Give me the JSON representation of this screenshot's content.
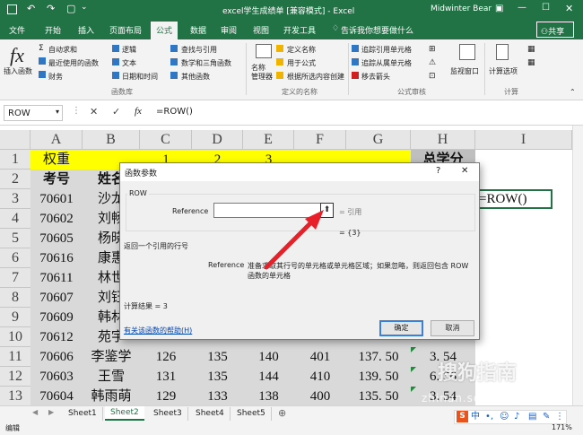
{
  "window": {
    "title": "excel学生成绩单 [兼容模式] - Excel",
    "user": "Midwinter Bear"
  },
  "tabs": [
    "文件",
    "开始",
    "插入",
    "页面布局",
    "公式",
    "数据",
    "审阅",
    "视图",
    "开发工具"
  ],
  "tell_me": "告诉我你想要做什么",
  "share": "共享",
  "ribbon": {
    "insert_function": "插入函数",
    "lib_col1": [
      "自动求和",
      "最近使用的函数",
      "财务"
    ],
    "lib_col2": [
      "逻辑",
      "文本",
      "日期和时间"
    ],
    "lib_col3": [
      "查找与引用",
      "数学和三角函数",
      "其他函数"
    ],
    "lib_group": "函数库",
    "name_manager": "名称\n管理器",
    "names_col": [
      "定义名称",
      "用于公式",
      "根据所选内容创建"
    ],
    "names_group": "定义的名称",
    "audit_col": [
      "追踪引用单元格",
      "追踪从属单元格",
      "移去箭头"
    ],
    "audit_group": "公式审核",
    "watch": "监视窗口",
    "calc_options": "计算选项",
    "calc_group": "计算"
  },
  "formula_bar": {
    "name_box": "ROW",
    "fx": "fx",
    "formula": "=ROW()"
  },
  "columns": [
    "A",
    "B",
    "C",
    "D",
    "E",
    "F",
    "G",
    "H",
    "I"
  ],
  "rows": [
    "1",
    "2",
    "3",
    "4",
    "5",
    "6",
    "7",
    "8",
    "9",
    "10",
    "11",
    "12",
    "13"
  ],
  "cells": {
    "r1": [
      "权重",
      "",
      "1",
      "2",
      "3",
      "",
      "",
      "总学分",
      ""
    ],
    "r2": [
      "考号",
      "姓名",
      "",
      "",
      "",
      "",
      "",
      "",
      ""
    ],
    "a": [
      "70601",
      "70602",
      "70605",
      "70616",
      "70611",
      "70607",
      "70609",
      "70612",
      "70606",
      "70603",
      "70604"
    ],
    "b": [
      "沙龙",
      "刘畅",
      "杨晓",
      "康惠",
      "林世",
      "刘钰",
      "韩林",
      "苑宇",
      "李鉴学",
      "王雪",
      "韩雨萌"
    ],
    "c11": "126",
    "d11": "135",
    "e11": "140",
    "f11": "401",
    "g11": "137. 50",
    "h11": "3. 54",
    "c12": "131",
    "d12": "135",
    "e12": "144",
    "f12": "410",
    "g12": "139. 50",
    "h12": "6. 36",
    "c13": "129",
    "d13": "133",
    "e13": "138",
    "f13": "400",
    "g13": "135. 50",
    "h13": "3. 54",
    "i3": "=ROW()"
  },
  "dialog": {
    "title": "函数参数",
    "help_q": "?",
    "close": "✕",
    "fn_name": "ROW",
    "arg_label": "Reference",
    "arg_value": "",
    "arg_hint": "= 引用",
    "result_eq": "= {3}",
    "description": "返回一个引用的行号",
    "arg_desc_label": "Reference",
    "arg_desc": "准备求取其行号的单元格或单元格区域；如果忽略，则返回包含 ROW 函数的单元格",
    "calc_result": "计算结果 = 3",
    "help_link": "有关该函数的帮助(H)",
    "ok": "确定",
    "cancel": "取消"
  },
  "sheets": [
    "Sheet1",
    "Sheet2",
    "Sheet3",
    "Sheet4",
    "Sheet5"
  ],
  "active_sheet": "Sheet2",
  "status": {
    "mode": "编辑",
    "zoom": "171%"
  },
  "watermark": "搜狗指南",
  "watermark_url": "zhinan.sogou.com",
  "ime_label": "中",
  "colors": {
    "excel_green": "#217346",
    "yellow": "#ffff00",
    "arrow_red": "#e8202a"
  }
}
